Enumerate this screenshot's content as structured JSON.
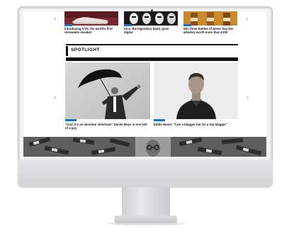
{
  "top_articles": [
    {
      "title": "Introducing VYN, the world's first renewable sneaker",
      "tag_color": "#2a6fb5"
    },
    {
      "title": "Kiss, the legendary band, goes digital",
      "tag_color": "#2a6fb5"
    },
    {
      "title": "Win three bottles of Never Say Die whiskey worth more than £200",
      "tag_color": "#2a6fb5"
    }
  ],
  "section": {
    "title": "SPOTLIGHT"
  },
  "features": [
    {
      "title": "\"God, it's an absolute shitshow!\" Daniel Mays is one hell of a guy",
      "tag_color": "#2a6fb5"
    },
    {
      "title": "Eddie Hearn: \"I am a blagger but I'm a top blagger\"",
      "tag_color": "#2a6fb5"
    }
  ],
  "nav": {
    "prev": "‹",
    "next": "›"
  }
}
